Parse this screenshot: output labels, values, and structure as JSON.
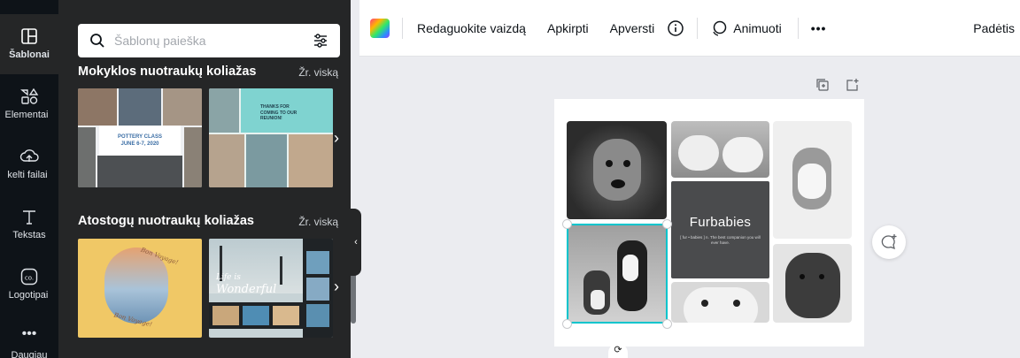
{
  "rail": {
    "items": [
      {
        "label": "Šablonai",
        "icon": "templates-icon"
      },
      {
        "label": "Elementai",
        "icon": "elements-icon"
      },
      {
        "label": "kelti failai",
        "icon": "upload-icon"
      },
      {
        "label": "Tekstas",
        "icon": "text-icon"
      },
      {
        "label": "Logotipai",
        "icon": "logo-icon"
      },
      {
        "label": "Daugiau",
        "icon": "more-icon"
      }
    ]
  },
  "panel": {
    "search_placeholder": "Šablonų paieška",
    "sections": [
      {
        "title": "Mokyklos nuotraukų koliažas",
        "see_all": "Žr. viską",
        "thumbs": [
          {
            "text1": "POTTERY CLASS",
            "text2": "JUNE 6-7, 2020"
          },
          {
            "text1": "THANKS FOR",
            "text2": "COMING TO OUR",
            "text3": "REUNION!"
          }
        ]
      },
      {
        "title": "Atostogų nuotraukų koliažas",
        "see_all": "Žr. viską",
        "thumbs": [
          {
            "text1": "Bon Voyage!",
            "text2": "Bon Voyage!"
          },
          {
            "text1": "Life is",
            "text2": "Wonderful"
          }
        ]
      }
    ]
  },
  "toolbar": {
    "edit_image": "Redaguokite vaizdą",
    "crop": "Apkirpti",
    "flip": "Apversti",
    "animate": "Animuoti",
    "more": "•••",
    "position": "Padėtis"
  },
  "canvas": {
    "title": "Furbabies",
    "subtitle": "[ fur • babies ] n. The best companion you will ever have."
  },
  "colors": {
    "rail_bg": "#0e1318",
    "panel_bg": "#252627",
    "selection": "#00c4cc"
  }
}
